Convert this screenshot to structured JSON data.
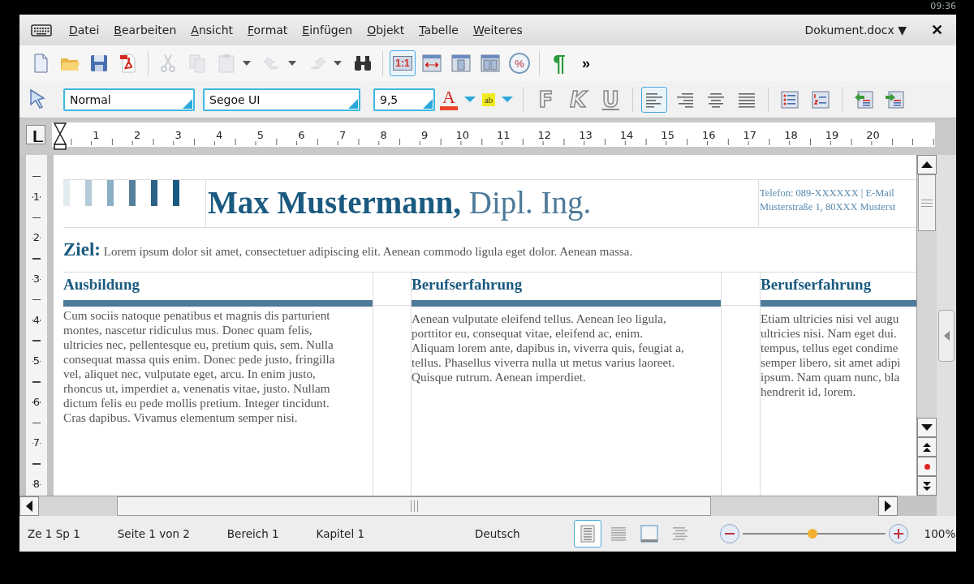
{
  "status_clock": "09:36",
  "menu": {
    "items": [
      "Datei",
      "Bearbeiten",
      "Ansicht",
      "Format",
      "Einfügen",
      "Objekt",
      "Tabelle",
      "Weiteres"
    ],
    "document": "Dokument.docx ▼",
    "close": "✕"
  },
  "toolbar_1": [
    {
      "kind": "new",
      "disabled": false,
      "selected": false
    },
    {
      "kind": "open",
      "disabled": false,
      "selected": false
    },
    {
      "kind": "save",
      "disabled": false,
      "selected": false
    },
    {
      "kind": "pdf",
      "disabled": false,
      "selected": false
    },
    {
      "kind": "sep"
    },
    {
      "kind": "cut",
      "disabled": true,
      "selected": false
    },
    {
      "kind": "copy",
      "disabled": true,
      "selected": false
    },
    {
      "kind": "paste",
      "disabled": true,
      "selected": false
    },
    {
      "kind": "drop"
    },
    {
      "kind": "undo",
      "disabled": true,
      "selected": false
    },
    {
      "kind": "drop"
    },
    {
      "kind": "redo",
      "disabled": true,
      "selected": false
    },
    {
      "kind": "drop"
    },
    {
      "kind": "find",
      "disabled": false,
      "selected": false
    },
    {
      "kind": "sep"
    },
    {
      "kind": "zoom",
      "glyph": "1:1",
      "disabled": false,
      "selected": true
    },
    {
      "kind": "pagewidth",
      "disabled": false,
      "selected": false
    },
    {
      "kind": "onepage",
      "disabled": false,
      "selected": false
    },
    {
      "kind": "twopages",
      "disabled": false,
      "selected": false
    },
    {
      "kind": "zoompct",
      "glyph": "%",
      "disabled": false,
      "selected": false
    },
    {
      "kind": "sep"
    },
    {
      "kind": "pilcrow",
      "glyph": "¶",
      "disabled": false,
      "selected": false
    },
    {
      "kind": "more",
      "glyph": "»"
    }
  ],
  "toolbar_2": {
    "style": "Normal",
    "font": "Segoe UI",
    "size": "9,5",
    "font_color_glyph": "A",
    "highlight_glyph": "ab",
    "format": [
      {
        "glyph": "F",
        "kind": "bold"
      },
      {
        "glyph": "K",
        "kind": "italic"
      },
      {
        "glyph": "U",
        "kind": "underline"
      }
    ],
    "align": [
      {
        "kind": "left",
        "selected": true
      },
      {
        "kind": "right",
        "selected": false
      },
      {
        "kind": "center",
        "selected": false
      },
      {
        "kind": "justify",
        "selected": false
      }
    ]
  },
  "ruler": {
    "marks": [
      "1",
      "2",
      "3",
      "4",
      "5",
      "6",
      "7",
      "8",
      "9",
      "10",
      "11",
      "12",
      "13",
      "14",
      "15",
      "16",
      "17",
      "18",
      "19",
      "20"
    ],
    "vertical_marks": [
      "1",
      "2",
      "3",
      "4",
      "5",
      "6",
      "7",
      "8"
    ]
  },
  "document": {
    "name": "**Max Mustermann,** Dipl. Ing.",
    "contact": [
      "Telefon: 089-XXXXXX | E-Mail",
      "Musterstraße 1, 80XXX Musterst"
    ],
    "objective": "**Ziel:** Lorem ipsum dolor sit amet, consectetuer adipiscing elit. Aenean commodo ligula eget dolor. Aenean massa.",
    "columns": [
      {
        "heading": "Ausbildung",
        "text": "Cum sociis natoque penatibus et magnis dis parturient\nmontes, nascetur ridiculus mus. Donec quam felis,\nultricies nec, pellentesque eu, pretium quis, sem. Nulla\nconsequat massa quis enim. Donec pede justo, fringilla\nvel, aliquet nec, vulputate eget, arcu. In enim justo,\nrhoncus ut, imperdiet a, venenatis vitae, justo. Nullam\ndictum felis eu pede mollis pretium. Integer tincidunt.\nCras dapibus. Vivamus elementum semper nisi."
      },
      {
        "heading": "Berufserfahrung",
        "text": "Aenean vulputate eleifend tellus. Aenean leo ligula,\nporttitor eu, consequat vitae, eleifend ac, enim.\nAliquam lorem ante, dapibus in, viverra quis, feugiat a,\ntellus. Phasellus viverra nulla ut metus varius laoreet.\nQuisque rutrum. Aenean imperdiet."
      },
      {
        "heading": "Berufserfahrung",
        "text": "Etiam ultricies nisi vel augu\nultricies nisi. Nam eget dui.\ntempus, tellus eget condime\nsemper libero, sit amet adipi\nipsum. Nam quam nunc, bla\nhendrerit id, lorem."
      }
    ]
  },
  "status_bar": {
    "fields": [
      "Ze 1 Sp 1",
      "Seite 1 von 2",
      "Bereich 1",
      "Kapitel 1"
    ],
    "language": "Deutsch",
    "views": [
      {
        "kind": "normal",
        "selected": true
      },
      {
        "kind": "web",
        "selected": false
      },
      {
        "kind": "book",
        "selected": false
      },
      {
        "kind": "outline",
        "selected": false
      }
    ],
    "zoom": {
      "level": 0.49,
      "reading": "100%"
    }
  }
}
